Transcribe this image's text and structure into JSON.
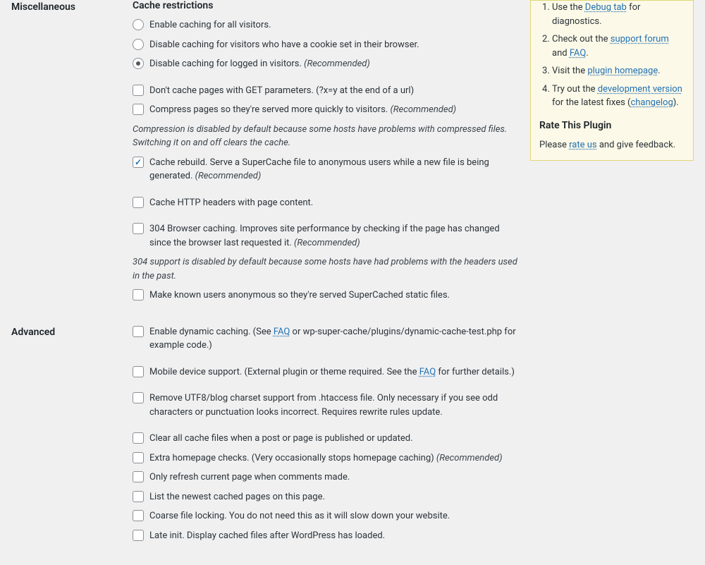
{
  "sections": {
    "misc": {
      "label": "Miscellaneous",
      "heading": "Cache restrictions",
      "radios": [
        "Enable caching for all visitors.",
        "Disable caching for visitors who have a cookie set in their browser.",
        "Disable caching for logged in visitors."
      ],
      "radio_rec": "(Recommended)",
      "checks": {
        "get_params": "Don't cache pages with GET parameters. (?x=y at the end of a url)",
        "compress": "Compress pages so they're served more quickly to visitors.",
        "compress_rec": "(Recommended)",
        "compress_note": "Compression is disabled by default because some hosts have problems with compressed files. Switching it on and off clears the cache.",
        "rebuild": "Cache rebuild. Serve a SuperCache file to anonymous users while a new file is being generated.",
        "rebuild_rec": "(Recommended)",
        "http_headers": "Cache HTTP headers with page content.",
        "browser304": "304 Browser caching. Improves site performance by checking if the page has changed since the browser last requested it.",
        "browser304_rec": "(Recommended)",
        "browser304_note": "304 support is disabled by default because some hosts have had problems with the headers used in the past.",
        "anon_known": "Make known users anonymous so they're served SuperCached static files."
      }
    },
    "advanced": {
      "label": "Advanced",
      "dynamic_pre": "Enable dynamic caching. (See ",
      "dynamic_link": "FAQ",
      "dynamic_post": " or wp-super-cache/plugins/dynamic-cache-test.php for example code.)",
      "mobile_pre": "Mobile device support. (External plugin or theme required. See the ",
      "mobile_link": "FAQ",
      "mobile_post": " for further details.)",
      "utf8": "Remove UTF8/blog charset support from .htaccess file. Only necessary if you see odd characters or punctuation looks incorrect. Requires rewrite rules update.",
      "clear_cache": "Clear all cache files when a post or page is published or updated.",
      "extra_home": "Extra homepage checks. (Very occasionally stops homepage caching)",
      "extra_home_rec": "(Recommended)",
      "refresh_comments": "Only refresh current page when comments made.",
      "list_cached": "List the newest cached pages on this page.",
      "coarse_lock": "Coarse file locking. You do not need this as it will slow down your website.",
      "late_init": "Late init. Display cached files after WordPress has loaded."
    }
  },
  "sidebar": {
    "li1_pre": "Use the ",
    "li1_link": "Debug tab",
    "li1_post": " for diagnostics.",
    "li2_pre": "Check out the ",
    "li2_link1": "support forum",
    "li2_mid": " and ",
    "li2_link2": "FAQ",
    "li2_post": ".",
    "li3_pre": "Visit the ",
    "li3_link": "plugin homepage",
    "li3_post": ".",
    "li4_pre": "Try out the ",
    "li4_link1": "development version",
    "li4_mid": " for the latest fixes (",
    "li4_link2": "changelog",
    "li4_post": ").",
    "rate_heading": "Rate This Plugin",
    "rate_pre": "Please ",
    "rate_link": "rate us",
    "rate_post": " and give feedback."
  }
}
